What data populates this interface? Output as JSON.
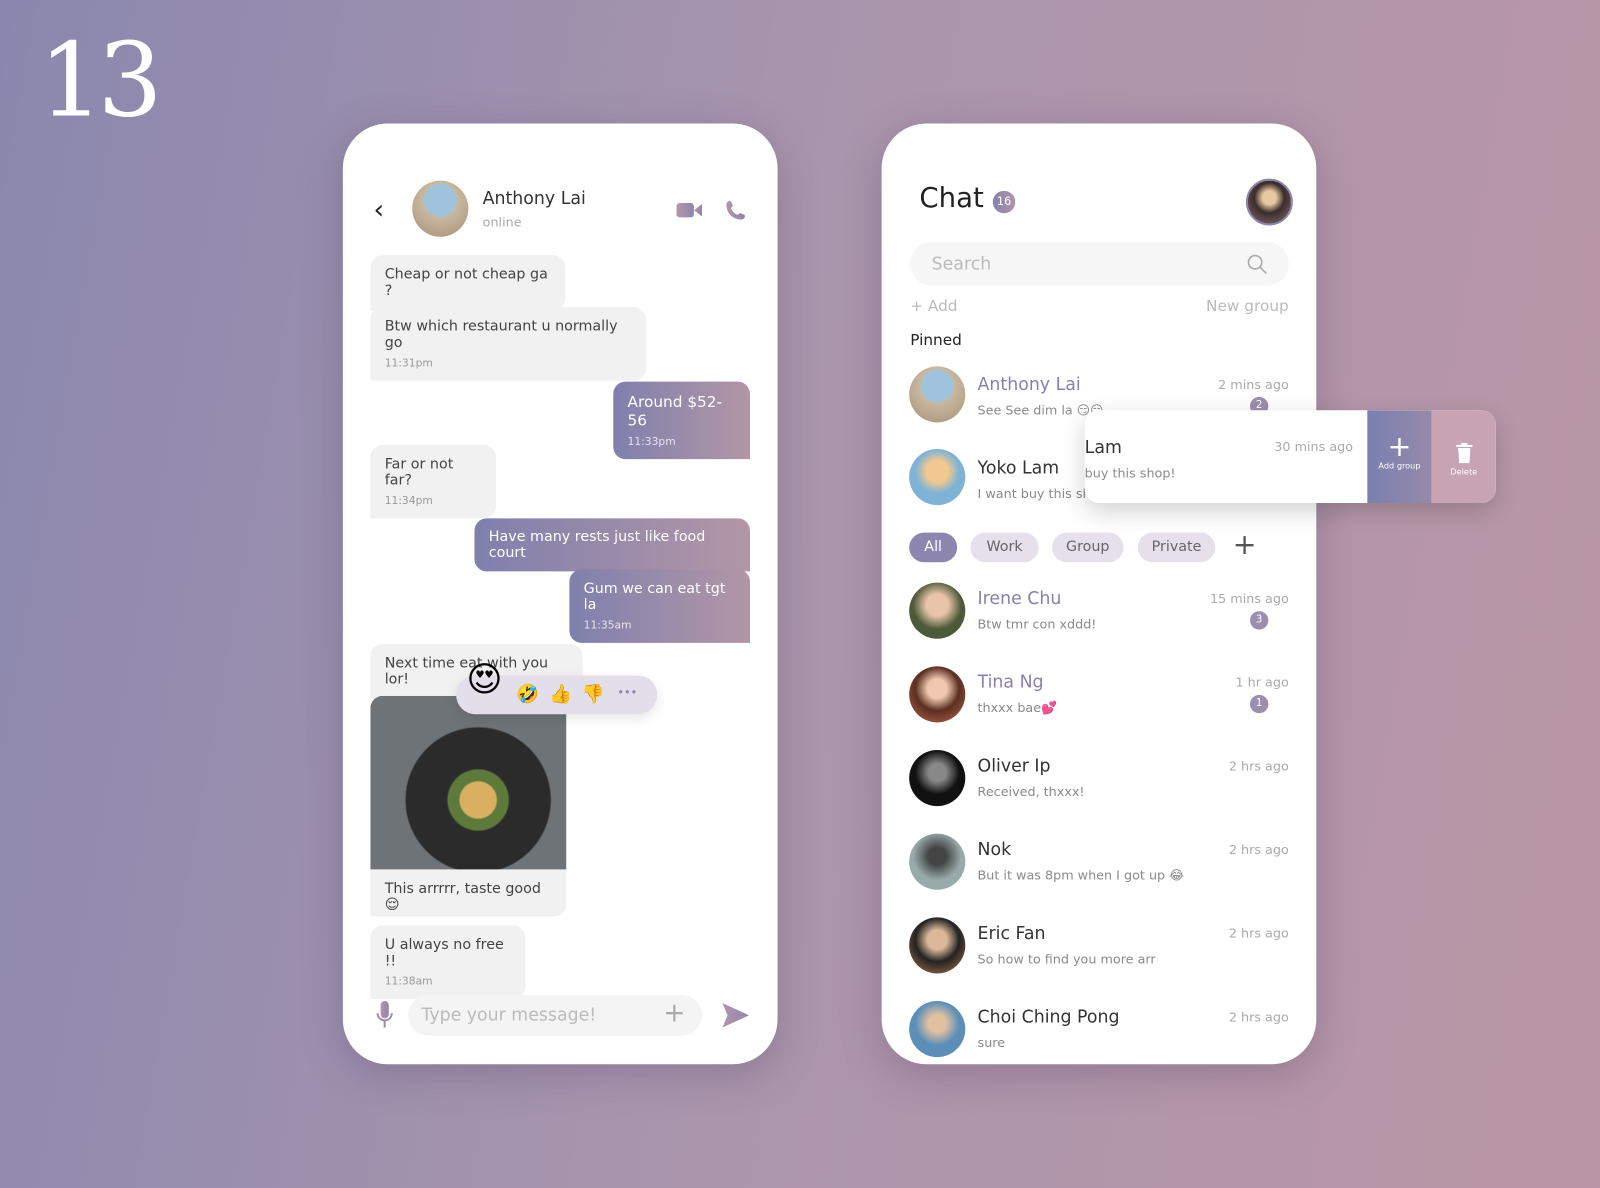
{
  "page_number": "13",
  "conversation": {
    "contact_name": "Anthony Lai",
    "status": "online",
    "icons": {
      "back": "chevron-left-icon",
      "video": "video-camera-icon",
      "call": "phone-icon",
      "mic": "microphone-icon",
      "plus": "plus-icon",
      "send": "send-icon"
    },
    "messages": [
      {
        "text": "Cheap or not cheap ga ?",
        "time": null,
        "side": "left"
      },
      {
        "text": "Btw which restaurant u normally go",
        "time": "11:31pm",
        "side": "left"
      },
      {
        "text": "Around $52-56",
        "time": "11:33pm",
        "side": "right"
      },
      {
        "text": "Far or not far?",
        "time": "11:34pm",
        "side": "left"
      },
      {
        "text": "Have many rests just like food court",
        "time": null,
        "side": "right"
      },
      {
        "text": "Gum we can eat tgt la",
        "time": "11:35am",
        "side": "right"
      },
      {
        "text": "Next time eat with you lor!",
        "time": null,
        "side": "left"
      },
      {
        "text": "This arrrrr, taste good 😌",
        "time": null,
        "side": "left"
      },
      {
        "text": "U always no free !!",
        "time": "11:38am",
        "side": "left"
      }
    ],
    "reactions": [
      "😍",
      "🤣",
      "👍",
      "👎",
      "•••"
    ],
    "input_placeholder": "Type your message!"
  },
  "chat_list": {
    "title": "Chat",
    "unread_count": "16",
    "search_placeholder": "Search",
    "add_label": "Add",
    "new_group_label": "New group",
    "pinned_label": "Pinned",
    "pinned": [
      {
        "name": "Anthony Lai",
        "preview": "See See dim la 😏😏",
        "time": "2 mins ago",
        "badge": "2"
      },
      {
        "name": "Yoko Lam",
        "preview": "I want buy this shop!",
        "time": "30 mins ago",
        "swiped_name": "Lam",
        "swiped_preview": "buy this shop!"
      }
    ],
    "swipe_actions": {
      "add_group": "Add group",
      "delete": "Delete"
    },
    "filters": [
      "All",
      "Work",
      "Group",
      "Private"
    ],
    "active_filter": "All",
    "chats": [
      {
        "name": "Irene Chu",
        "preview": "Btw tmr con xddd!",
        "time": "15 mins ago",
        "badge": "3"
      },
      {
        "name": "Tina Ng",
        "preview": "thxxx bae💕",
        "time": "1 hr ago",
        "badge": "1"
      },
      {
        "name": "Oliver Ip",
        "preview": "Received, thxxx!",
        "time": "2 hrs ago",
        "badge": null
      },
      {
        "name": "Nok",
        "preview": "But it was 8pm when I got up 😂",
        "time": "2 hrs ago",
        "badge": null
      },
      {
        "name": "Eric Fan",
        "preview": "So how to find you more arr",
        "time": "2 hrs ago",
        "badge": null
      },
      {
        "name": "Choi Ching Pong",
        "preview": "sure",
        "time": "2 hrs ago",
        "badge": null
      }
    ]
  },
  "colors": {
    "accent": "#8b86b0",
    "accent_end": "#b698a8",
    "highlight_name": "#8a7fb0"
  }
}
